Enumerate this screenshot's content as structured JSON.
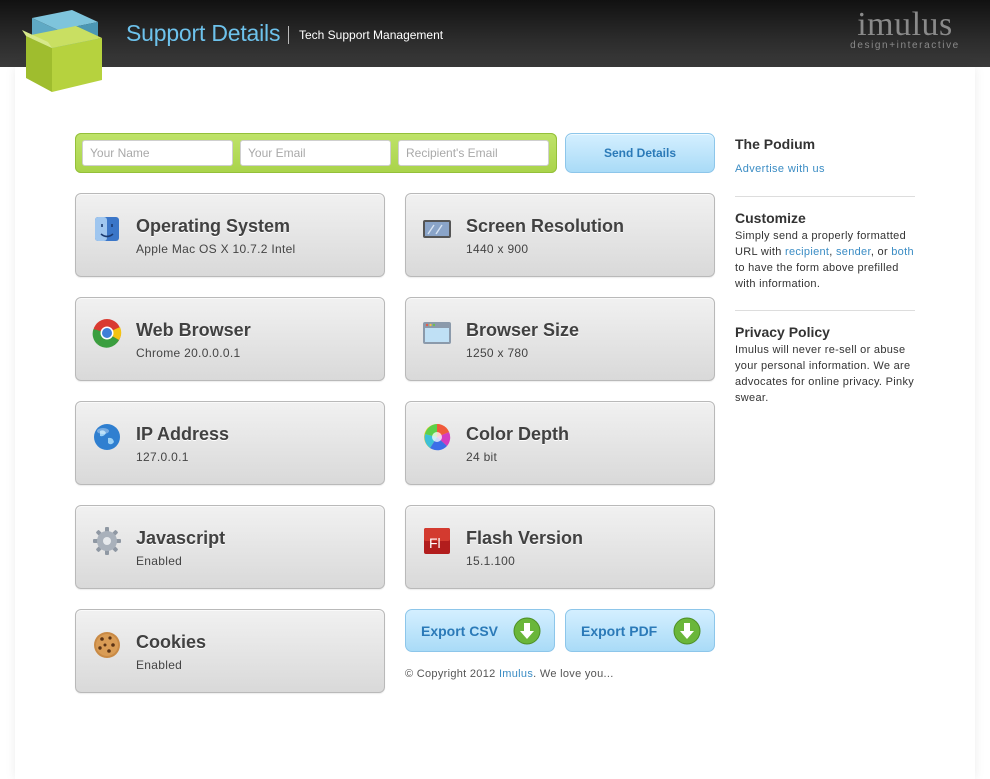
{
  "header": {
    "title": "Support Details",
    "subtitle": "Tech Support Management",
    "brand_name": "imulus",
    "brand_tagline": "design+interactive"
  },
  "form": {
    "name_placeholder": "Your Name",
    "email_placeholder": "Your Email",
    "recipient_placeholder": "Recipient's Email",
    "send_label": "Send Details"
  },
  "cards": [
    {
      "title": "Operating System",
      "value": "Apple Mac OS X 10.7.2 Intel",
      "icon": "finder-icon"
    },
    {
      "title": "Screen Resolution",
      "value": "1440 x 900",
      "icon": "display-icon"
    },
    {
      "title": "Web Browser",
      "value": "Chrome 20.0.0.0.1",
      "icon": "chrome-icon"
    },
    {
      "title": "Browser Size",
      "value": "1250 x 780",
      "icon": "browser-window-icon"
    },
    {
      "title": "IP Address",
      "value": "127.0.0.1",
      "icon": "globe-icon"
    },
    {
      "title": "Color Depth",
      "value": "24 bit",
      "icon": "color-wheel-icon"
    },
    {
      "title": "Javascript",
      "value": "Enabled",
      "icon": "gear-icon"
    },
    {
      "title": "Flash Version",
      "value": "15.1.100",
      "icon": "flash-icon"
    },
    {
      "title": "Cookies",
      "value": "Enabled",
      "icon": "cookie-icon"
    }
  ],
  "export": {
    "csv_label": "Export CSV",
    "pdf_label": "Export PDF"
  },
  "footer": {
    "copyright_prefix": "© Copyright 2012",
    "copyright_link": "Imulus",
    "copyright_suffix": ". We love you..."
  },
  "sidebar": {
    "podium_heading": "The Podium",
    "podium_link": "Advertise with us",
    "customize_heading": "Customize",
    "customize_text_1": "Simply send a properly formatted URL with",
    "customize_link_recipient": "recipient",
    "customize_sep_1": ",",
    "customize_link_sender": "sender",
    "customize_sep_2": ", or",
    "customize_link_both": "both",
    "customize_text_2": "to have the form above prefilled with information.",
    "privacy_heading": "Privacy Policy",
    "privacy_text": "Imulus will never re-sell or abuse your personal information. We are advocates for online privacy. Pinky swear."
  },
  "colors": {
    "accent_blue": "#6dc2ec",
    "link_blue": "#3a8cc4",
    "form_green": "#a9d34a",
    "header_dark": "#2a2a2a"
  }
}
